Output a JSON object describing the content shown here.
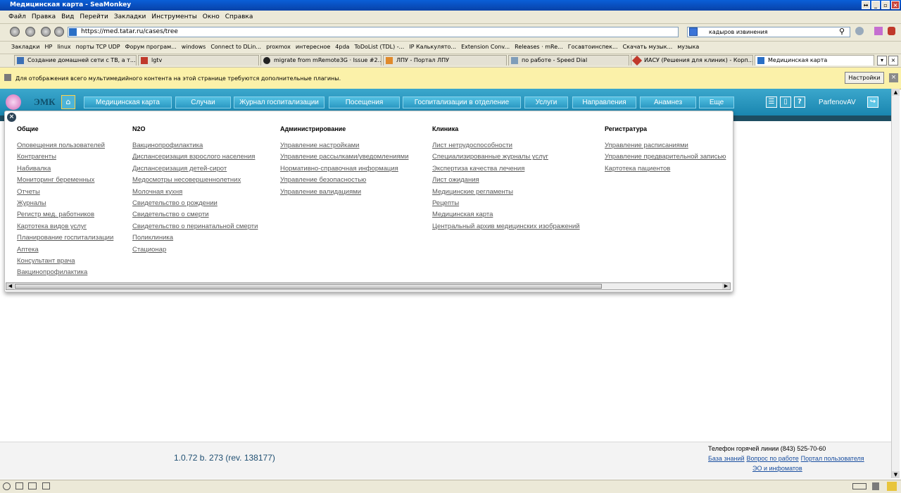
{
  "window": {
    "title": "Медицинская карта - SeaMonkey"
  },
  "menubar": [
    "Файл",
    "Правка",
    "Вид",
    "Перейти",
    "Закладки",
    "Инструменты",
    "Окно",
    "Справка"
  ],
  "navbar": {
    "url": "https://med.tatar.ru/cases/tree",
    "search_value": "кадыров извинения"
  },
  "bookmarks": [
    "Закладки",
    "HP",
    "linux",
    "порты TCP UDP",
    "Форум програм...",
    "windows",
    "Connect to DLin...",
    "proxmox",
    "интересное",
    "4pda",
    "ToDoList (TDL) -...",
    "IP Калькулято...",
    "Extension Conv...",
    "Releases · mRe...",
    "Госавтоинспек...",
    "Скачать музык...",
    "музыка"
  ],
  "tabs": [
    "Создание домашней сети с ТВ, а т...",
    "lgtv",
    "migrate from mRemote3G · Issue #2...",
    "ЛПУ - Портал ЛПУ",
    "по работе - Speed Dial",
    "ИАСУ (Решения для клиник) - Корп...",
    "Медицинская карта"
  ],
  "plugin_bar": {
    "message": "Для отображения всего мультимедийного контента на этой странице требуются дополнительные плагины.",
    "button": "Настройки"
  },
  "app": {
    "brand": "ЭМК",
    "nav": [
      "Медицинская карта",
      "Случаи",
      "Журнал госпитализации",
      "Посещения",
      "Госпитализации в отделение",
      "Услуги",
      "Направления",
      "Анамнез",
      "Еще"
    ],
    "help_icon": "?",
    "user": "ParfenovAV"
  },
  "menu_columns": [
    {
      "title": "Общие",
      "items": [
        "Оповещения пользователей",
        "Контрагенты",
        "Набивалка",
        "Мониторинг беременных",
        "Отчеты",
        "Журналы",
        "Регистр мед. работников",
        "Картотека видов услуг",
        "Планирование госпитализации",
        "Аптека",
        "Консультант врача",
        "Вакцинопрофилактика"
      ]
    },
    {
      "title": "N2O",
      "items": [
        "Вакцинопрофилактика",
        "Диспансеризация взрослого населения",
        "Диспансеризация детей-сирот",
        "Медосмотры несовершеннолетних",
        "Молочная кухня",
        "Свидетельство о рождении",
        "Свидетельство о смерти",
        "Свидетельство о перинатальной смерти",
        "Поликлиника",
        "Стационар"
      ]
    },
    {
      "title": "Администрирование",
      "items": [
        "Управление настройками",
        "Управление рассылками/уведомлениями",
        "Нормативно-справочная информация",
        "Управление безопасностью",
        "Управление валидациями"
      ]
    },
    {
      "title": "Клиника",
      "items": [
        "Лист нетрудоспособности",
        "Специализированные журналы услуг",
        "Экспертиза качества лечения",
        "Лист ожидания",
        "Медицинские регламенты",
        "Рецепты",
        "Медицинская карта",
        "Центральный архив медицинских изображений"
      ]
    },
    {
      "title": "Регистратура",
      "items": [
        "Управление расписаниями",
        "Управление предварительной записью",
        "Картотека пациентов"
      ]
    }
  ],
  "footer": {
    "version": "1.0.72 b. 273 (rev. 138177)",
    "hotline": "Телефон горячей линии (843) 525-70-60",
    "links": [
      "База знаний",
      "Вопрос по работе",
      "Портал пользователя",
      "ЭО и инфоматов"
    ]
  },
  "colors": {
    "header": "#2596be",
    "link": "#5a5a5a",
    "footer_link": "#1a4fa0"
  }
}
